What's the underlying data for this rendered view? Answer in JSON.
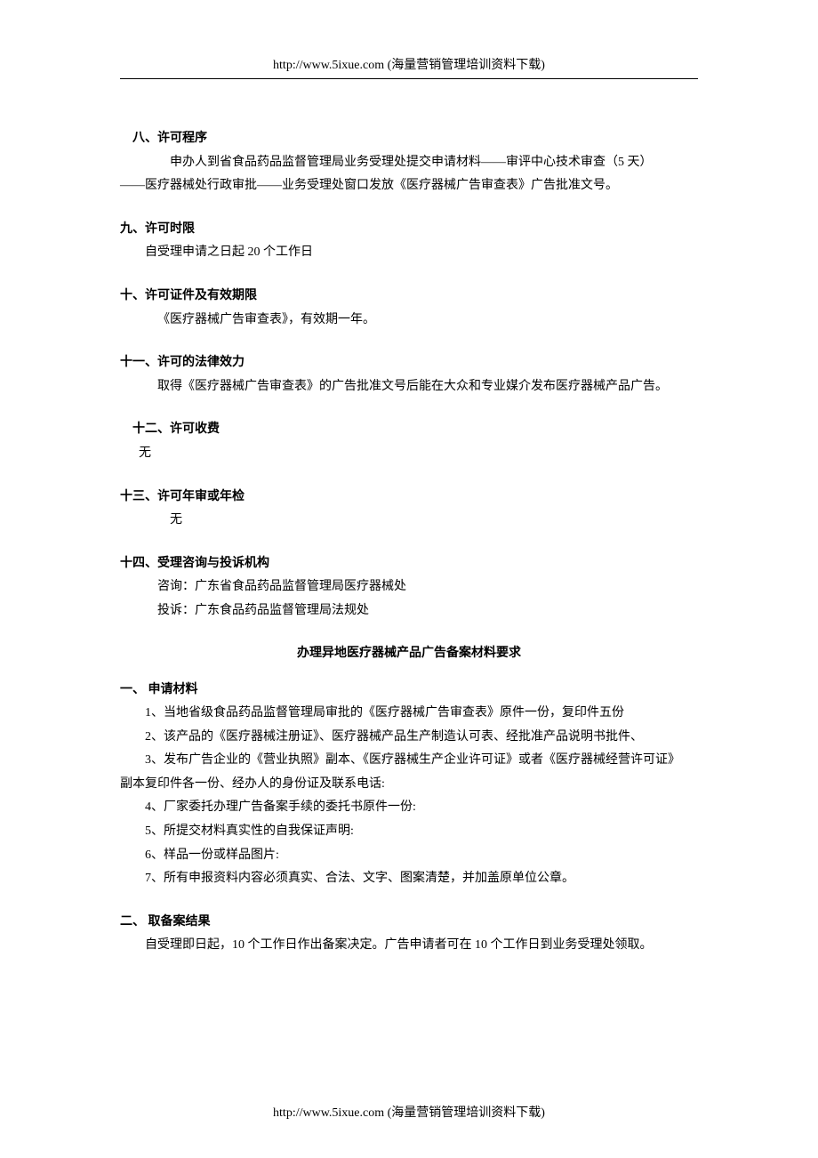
{
  "header": "http://www.5ixue.com   (海量营销管理培训资料下载)",
  "footer": "http://www.5ixue.com (海量营销管理培训资料下载)",
  "sections": {
    "s8": {
      "heading": "八、许可程序",
      "body1": "申办人到省食品药品监督管理局业务受理处提交申请材料——审评中心技术审查（5 天）",
      "body2": "——医疗器械处行政审批——业务受理处窗口发放《医疗器械广告审查表》广告批准文号。"
    },
    "s9": {
      "heading": "九、许可时限",
      "body": "自受理申请之日起 20 个工作日"
    },
    "s10": {
      "heading": "十、许可证件及有效期限",
      "body": "《医疗器械广告审查表》，有效期一年。"
    },
    "s11": {
      "heading": "十一、许可的法律效力",
      "body": "取得《医疗器械广告审查表》的广告批准文号后能在大众和专业媒介发布医疗器械产品广告。"
    },
    "s12": {
      "heading": "十二、许可收费",
      "body": "无"
    },
    "s13": {
      "heading": "十三、许可年审或年检",
      "body": "无"
    },
    "s14": {
      "heading": "十四、受理咨询与投诉机构",
      "body1": "咨询：广东省食品药品监督管理局医疗器械处",
      "body2": "投诉：广东食品药品监督管理局法规处"
    }
  },
  "subtitle": "办理异地医疗器械产品广告备案材料要求",
  "part1": {
    "heading": "一、  申请材料",
    "items": {
      "i1": "1、当地省级食品药品监督管理局审批的《医疗器械广告审查表》原件一份，复印件五份",
      "i2": "2、该产品的《医疗器械注册证》、医疗器械产品生产制造认可表、经批准产品说明书批件、",
      "i3a": "3、发布广告企业的《营业执照》副本、《医疗器械生产企业许可证》或者《医疗器械经营许可证》",
      "i3b": "副本复印件各一份、经办人的身份证及联系电话:",
      "i4": "4、厂家委托办理广告备案手续的委托书原件一份:",
      "i5": "5、所提交材料真实性的自我保证声明:",
      "i6": "6、样品一份或样品图片:",
      "i7": "7、所有申报资料内容必须真实、合法、文字、图案清楚，并加盖原单位公章。"
    }
  },
  "part2": {
    "heading": "二、  取备案结果",
    "body": "自受理即日起，10 个工作日作出备案决定。广告申请者可在 10 个工作日到业务受理处领取。"
  }
}
